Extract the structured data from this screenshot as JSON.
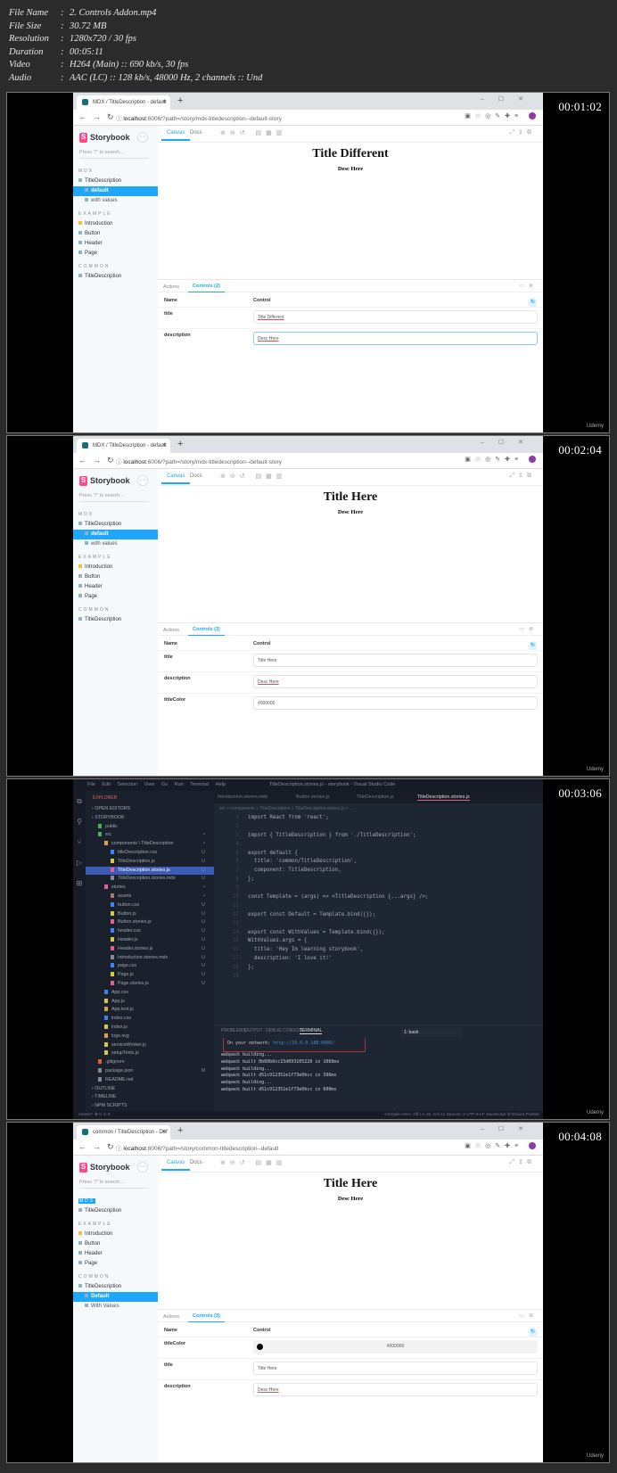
{
  "meta": [
    {
      "key": "File Name",
      "value": "2. Controls Addon.mp4"
    },
    {
      "key": "File Size",
      "value": "30.72 MB"
    },
    {
      "key": "Resolution",
      "value": "1280x720 / 30 fps"
    },
    {
      "key": "Duration",
      "value": "00:05:11"
    },
    {
      "key": "Video",
      "value": "H264 (Main) :: 690 kb/s, 30 fps"
    },
    {
      "key": "Audio",
      "value": "AAC (LC) :: 128 kb/s, 48000 Hz, 2 channels :: Und"
    }
  ],
  "watermark": "Udemy",
  "storybook_common": {
    "brand": "Storybook",
    "search_placeholder": "Press \"/\" to search...",
    "canvas_tab": "Canvas",
    "docs_tab": "Docs",
    "actions_tab": "Actions",
    "name_header": "Name",
    "control_header": "Control",
    "new_tab": "+",
    "close_tab": "×"
  },
  "frames": [
    {
      "kind": "storybook",
      "timestamp": "00:01:02",
      "tab_title": "MDX / TitleDescription - default",
      "url_host": "localhost",
      "url_rest": ":6006/?path=/story/mdx-titledescription--default-story",
      "tree": [
        {
          "type": "group",
          "label": "MDX"
        },
        {
          "type": "item",
          "label": "TitleDescription"
        },
        {
          "type": "child",
          "label": "default",
          "active": true
        },
        {
          "type": "child",
          "label": "with values"
        },
        {
          "type": "group",
          "label": "EXAMPLE"
        },
        {
          "type": "item",
          "label": "Introduction",
          "icon": "y"
        },
        {
          "type": "item",
          "label": "Button"
        },
        {
          "type": "item",
          "label": "Header"
        },
        {
          "type": "item",
          "label": "Page"
        },
        {
          "type": "group",
          "label": "COMMON"
        },
        {
          "type": "item",
          "label": "TitleDescription"
        }
      ],
      "story_title": "Title Different",
      "story_desc": "Desc Here",
      "controls_tab": "Controls (2)",
      "controls": [
        {
          "name": "title",
          "value": "Title Different",
          "style": "u"
        },
        {
          "name": "description",
          "value": "Desc Here",
          "style": "u focus"
        }
      ]
    },
    {
      "kind": "storybook",
      "timestamp": "00:02:04",
      "tab_title": "MDX / TitleDescription - default",
      "url_host": "localhost",
      "url_rest": ":6006/?path=/story/mdx-titledescription--default-story",
      "tree": [
        {
          "type": "group",
          "label": "MDX"
        },
        {
          "type": "item",
          "label": "TitleDescription"
        },
        {
          "type": "child",
          "label": "default",
          "active": true
        },
        {
          "type": "child",
          "label": "with values"
        },
        {
          "type": "group",
          "label": "EXAMPLE"
        },
        {
          "type": "item",
          "label": "Introduction",
          "icon": "y"
        },
        {
          "type": "item",
          "label": "Button"
        },
        {
          "type": "item",
          "label": "Header"
        },
        {
          "type": "item",
          "label": "Page"
        },
        {
          "type": "group",
          "label": "COMMON"
        },
        {
          "type": "item",
          "label": "TitleDescription"
        }
      ],
      "story_title": "Title Here",
      "story_desc": "Desc Here",
      "controls_tab": "Controls (3)",
      "controls": [
        {
          "name": "title",
          "value": "Title Here",
          "style": ""
        },
        {
          "name": "description",
          "value": "Desc Here",
          "style": "u"
        },
        {
          "name": "titleColor",
          "value": "#000000",
          "style": ""
        }
      ]
    },
    {
      "kind": "vscode",
      "timestamp": "00:03:06",
      "menu": "File Edit Selection View Go Run Terminal Help",
      "window_title": "TitleDescription.stories.js - storybook - Visual Studio Code",
      "explorer_label": "EXPLORER",
      "explorer": [
        {
          "label": "OPEN EDITORS",
          "indent": 1,
          "section": true
        },
        {
          "label": "STORYBOOK",
          "indent": 1,
          "section": true
        },
        {
          "label": "public",
          "indent": 2,
          "color": "#4caf50"
        },
        {
          "label": "src",
          "indent": 2,
          "color": "#4caf50",
          "status": "•"
        },
        {
          "label": "components \\ TitleDescription",
          "indent": 3,
          "color": "#d9a441",
          "status": "•"
        },
        {
          "label": "titleDescription.css",
          "indent": 4,
          "color": "#3b82f6",
          "status": "U"
        },
        {
          "label": "TitleDescription.js",
          "indent": 4,
          "color": "#d6c84a",
          "status": "U"
        },
        {
          "label": "TitleDescription.stories.js",
          "indent": 4,
          "color": "#e06090",
          "status": "U",
          "selected": true
        },
        {
          "label": "TitleDescription.stories.mdx",
          "indent": 4,
          "color": "#889",
          "status": "U"
        },
        {
          "label": "stories",
          "indent": 3,
          "color": "#e06090",
          "status": "•"
        },
        {
          "label": "assets",
          "indent": 4,
          "color": "#a77",
          "status": "•"
        },
        {
          "label": "button.css",
          "indent": 4,
          "color": "#3b82f6",
          "status": "U"
        },
        {
          "label": "Button.js",
          "indent": 4,
          "color": "#d6c84a",
          "status": "U"
        },
        {
          "label": "Button.stories.js",
          "indent": 4,
          "color": "#e06090",
          "status": "U"
        },
        {
          "label": "header.css",
          "indent": 4,
          "color": "#3b82f6",
          "status": "U"
        },
        {
          "label": "Header.js",
          "indent": 4,
          "color": "#d6c84a",
          "status": "U"
        },
        {
          "label": "Header.stories.js",
          "indent": 4,
          "color": "#e06090",
          "status": "U"
        },
        {
          "label": "Introduction.stories.mdx",
          "indent": 4,
          "color": "#889",
          "status": "U"
        },
        {
          "label": "page.css",
          "indent": 4,
          "color": "#3b82f6",
          "status": "U"
        },
        {
          "label": "Page.js",
          "indent": 4,
          "color": "#d6c84a",
          "status": "U"
        },
        {
          "label": "Page.stories.js",
          "indent": 4,
          "color": "#e06090",
          "status": "U"
        },
        {
          "label": "App.css",
          "indent": 3,
          "color": "#3b82f6"
        },
        {
          "label": "App.js",
          "indent": 3,
          "color": "#d6c84a"
        },
        {
          "label": "App.test.js",
          "indent": 3,
          "color": "#d9a441"
        },
        {
          "label": "index.css",
          "indent": 3,
          "color": "#3b82f6"
        },
        {
          "label": "index.js",
          "indent": 3,
          "color": "#d6c84a"
        },
        {
          "label": "logo.svg",
          "indent": 3,
          "color": "#d9a441"
        },
        {
          "label": "serviceWorker.js",
          "indent": 3,
          "color": "#d6c84a"
        },
        {
          "label": "setupTests.js",
          "indent": 3,
          "color": "#d6c84a"
        },
        {
          "label": ".gitignore",
          "indent": 2,
          "color": "#e0603a"
        },
        {
          "label": "package.json",
          "indent": 2,
          "color": "#889",
          "status": "M"
        },
        {
          "label": "README.md",
          "indent": 2,
          "color": "#889"
        },
        {
          "label": "OUTLINE",
          "indent": 1,
          "section": true
        },
        {
          "label": "TIMELINE",
          "indent": 1,
          "section": true
        },
        {
          "label": "NPM SCRIPTS",
          "indent": 1,
          "section": true
        }
      ],
      "editor_tabs": [
        "Introduction.stories.mdx",
        "Button.stories.js",
        "TitleDescription.js",
        "TitleDescription.stories.js"
      ],
      "breadcrumb": "src > components > TitleDescription > TitleDescription.stories.js > ...",
      "code": [
        "import React from 'react';",
        "",
        "import { TitleDescription } from './TitleDescription';",
        "",
        "export default {",
        "  title: 'common/TitleDescription',",
        "  component: TitleDescription,",
        "};",
        "",
        "const Template = (args) => <TitleDescription {...args} />;",
        "",
        "export const Default = Template.bind({});",
        "",
        "export const WithValues = Template.bind({});",
        "WithValues.args = {",
        "  title: 'Hey Im learning storybook',",
        "  description: 'I love it!'",
        "};",
        ""
      ],
      "panel_tabs": [
        "PROBLEMS",
        "OUTPUT",
        "DEBUG CONSOLE",
        "TERMINAL"
      ],
      "terminal_select": "1: bash",
      "network_label": "On your network:",
      "network_url": "http://10.0.0.188:6006/",
      "terminal_lines": [
        "webpack building...",
        "webpack built 0b60b0cc15d0931052​20 in 1066ms",
        "webpack building...",
        "webpack built d51c912351e1f73e0bcc in 396ms",
        "webpack building...",
        "webpack built d51c912351e1f73e0bcc in 600ms"
      ],
      "status_left": "master*   ⊗ 0 ⚠ 0",
      "status_right": "Compile Hero: Off   Ln 15, Col 11   Spaces: 2   UTF-8   LF   JavaScript   ⊘ ESLint   Prettier"
    },
    {
      "kind": "storybook",
      "timestamp": "00:04:08",
      "tab_title": "common / TitleDescription - Def",
      "url_host": "localhost",
      "url_rest": ":6006/?path=/story/common-titledescription--default",
      "tree": [
        {
          "type": "group",
          "label": "MDX",
          "selected": true
        },
        {
          "type": "item",
          "label": "TitleDescription"
        },
        {
          "type": "group",
          "label": "EXAMPLE"
        },
        {
          "type": "item",
          "label": "Introduction",
          "icon": "y"
        },
        {
          "type": "item",
          "label": "Button"
        },
        {
          "type": "item",
          "label": "Header"
        },
        {
          "type": "item",
          "label": "Page"
        },
        {
          "type": "group",
          "label": "COMMON"
        },
        {
          "type": "item",
          "label": "TitleDescription"
        },
        {
          "type": "child",
          "label": "Default",
          "active": true
        },
        {
          "type": "child",
          "label": "With Values"
        }
      ],
      "story_title": "Title Here",
      "story_desc": "Desc Here",
      "controls_tab": "Controls (3)",
      "controls": [
        {
          "name": "titleColor",
          "value": "#000000",
          "style": "color"
        },
        {
          "name": "title",
          "value": "Title Here",
          "style": ""
        },
        {
          "name": "description",
          "value": "Desc Here",
          "style": "u"
        }
      ]
    }
  ]
}
